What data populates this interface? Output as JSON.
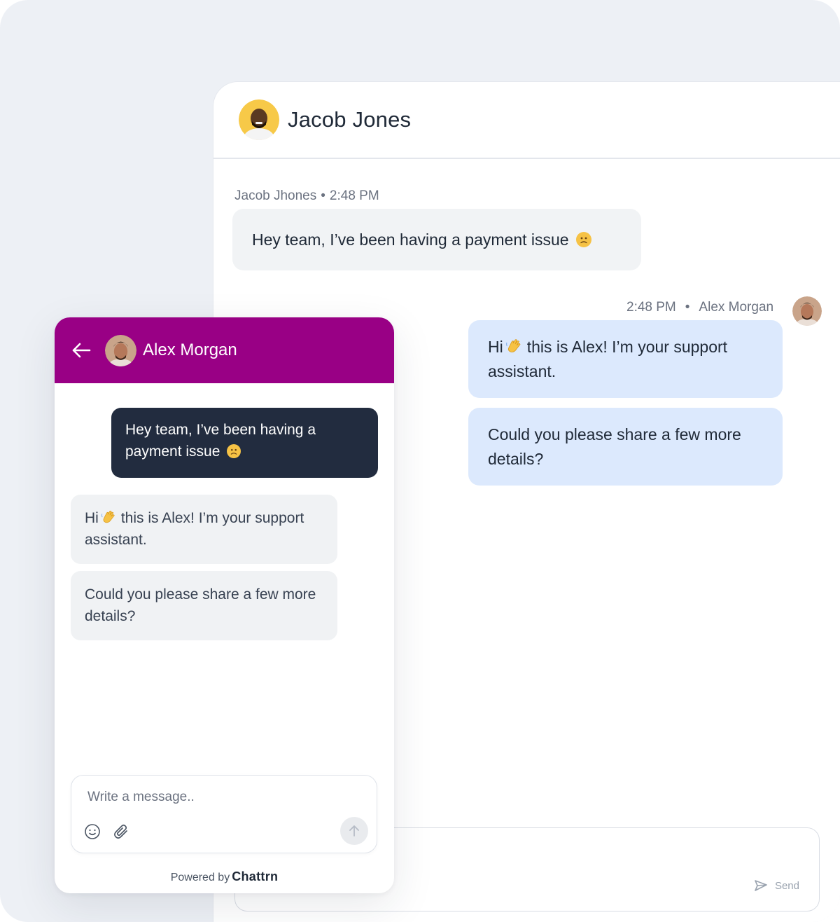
{
  "agent": {
    "contact_name": "Jacob Jones",
    "incoming": {
      "sender": "Jacob Jhones",
      "time": "2:48 PM",
      "text": "Hey team, I’ve been having a payment issue"
    },
    "outgoing": {
      "time": "2:48 PM",
      "sender": "Alex Morgan",
      "msg1_pre": "Hi",
      "msg1_post": "this is Alex! I’m your support assistant.",
      "msg2": "Could you please share a few more details?"
    },
    "send_label": "Send"
  },
  "widget": {
    "title": "Alex Morgan",
    "user_message": "Hey team, I’ve been having a payment issue",
    "bot_msg1_pre": "Hi",
    "bot_msg1_post": "this is Alex! I’m your support assistant.",
    "bot_msg2": "Could you please share a few more details?",
    "input_placeholder": "Write a message..",
    "powered_by": "Powered by",
    "brand": "Chattrn"
  },
  "icons": [
    "back-arrow-icon",
    "emoji-icon",
    "attachment-icon",
    "send-arrow-icon",
    "paper-plane-icon",
    "frown-emoji-icon",
    "wave-emoji-icon"
  ],
  "colors": {
    "widget_header": "#990085",
    "user_bubble": "#222c3f",
    "agent_bubble": "#dce9fd",
    "incoming_bubble": "#f1f3f5",
    "background": "#edf0f5"
  }
}
